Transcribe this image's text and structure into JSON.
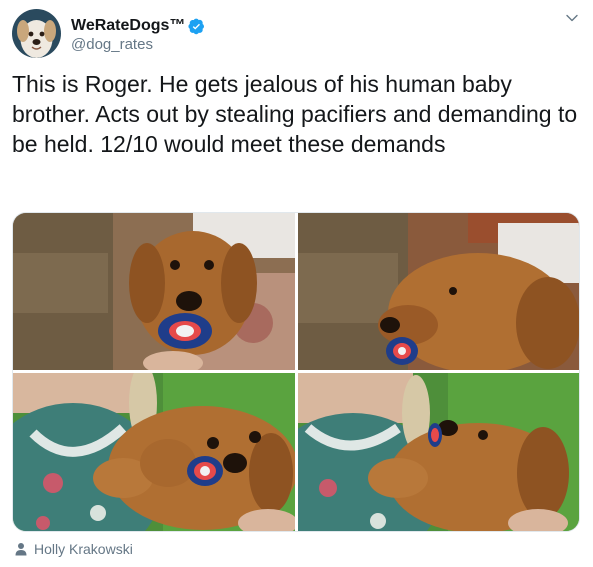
{
  "tweet": {
    "author": {
      "display_name": "WeRateDogs™",
      "handle": "@dog_rates",
      "verified": true,
      "avatar_icon": "dog-avatar"
    },
    "text": "This is Roger. He gets jealous of his human baby brother. Acts out by stealing pacifiers and demanding to be held. 12/10 would meet these demands",
    "media": {
      "photo_count": 4,
      "photos": [
        {
          "description_icon": "puppy-with-pacifier-photo"
        },
        {
          "description_icon": "puppy-with-pacifier-side-photo"
        },
        {
          "description_icon": "puppy-held-with-pacifier-photo"
        },
        {
          "description_icon": "puppy-held-sideways-photo"
        }
      ]
    },
    "photo_credit": "Holly Krakowski"
  },
  "colors": {
    "text": "#14171a",
    "secondary": "#657786",
    "verified_blue": "#1da1f2",
    "border": "#e1e8ed"
  }
}
